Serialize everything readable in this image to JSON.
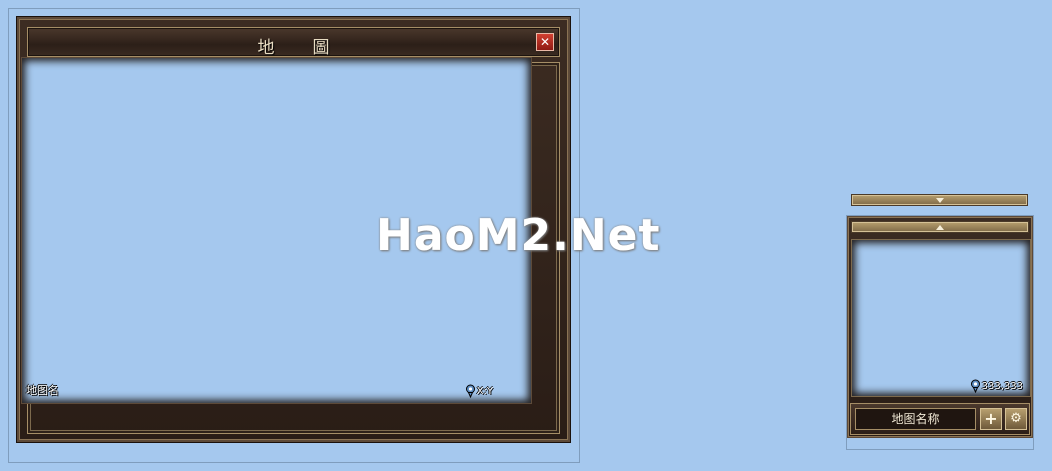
{
  "big_map": {
    "title": "地圖",
    "close_glyph": "✕",
    "map_name": "地图名",
    "coords": "X:Y"
  },
  "watermark": {
    "text": "HaoM2.Net"
  },
  "mini_map": {
    "coords": "333,333",
    "map_name": "地图名称",
    "add_glyph": "+",
    "gear_glyph": "⚙"
  },
  "icons": {
    "close": "close-icon",
    "pin": "location-pin-icon",
    "expand": "triangle-down-icon",
    "collapse": "triangle-up-icon",
    "add": "plus-icon",
    "settings": "gear-icon"
  },
  "colors": {
    "background": "#a5c8ee",
    "frame_dark": "#2a1d16",
    "frame_gold": "#a58e66",
    "close_red": "#b52a1f"
  }
}
